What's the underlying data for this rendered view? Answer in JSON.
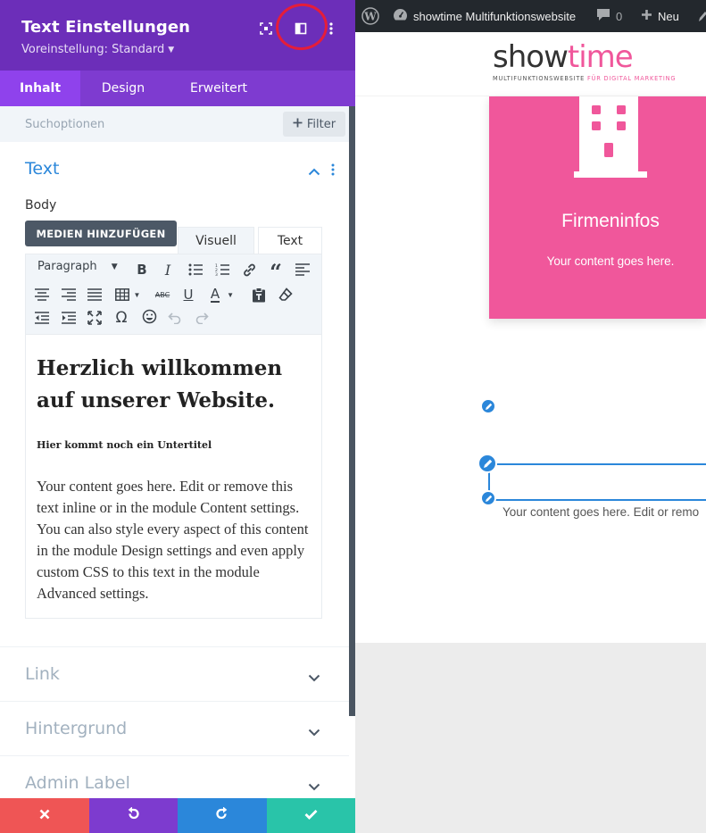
{
  "panel": {
    "title": "Text Einstellungen",
    "preset": "Voreinstellung: Standard",
    "header_icons": [
      "expand-icon",
      "sidebar-toggle-icon",
      "more-vertical-icon"
    ],
    "tabs": [
      {
        "label": "Inhalt",
        "active": true
      },
      {
        "label": "Design",
        "active": false
      },
      {
        "label": "Erweitert",
        "active": false
      }
    ],
    "search_placeholder": "Suchoptionen",
    "filter_label": "Filter",
    "section_text": {
      "title": "Text",
      "body_label": "Body",
      "media_button": "MEDIEN HINZUFÜGEN",
      "editor_tabs": [
        "Visuell",
        "Text"
      ],
      "paragraph_select": "Paragraph",
      "content_heading": "Herzlich willkommen auf unserer Website.",
      "content_subheading": "Hier kommt noch ein Untertitel",
      "content_paragraph": "Your content goes here. Edit or remove this text inline or in the module Content settings. You can also style every aspect of this content in the module Design settings and even apply custom CSS to this text in the module Advanced settings."
    },
    "collapsed_sections": [
      "Link",
      "Hintergrund",
      "Admin Label"
    ],
    "accent_colors": {
      "header": "#6c2eb9",
      "tabs": "#7e3bd0",
      "blue": "#2b87da",
      "discard": "#ef5555",
      "save": "#29c4a9"
    }
  },
  "adminbar": {
    "site_name": "showtime Multifunktionswebsite",
    "comments_count": "0",
    "new_label": "Neu"
  },
  "preview": {
    "logo_show": "show",
    "logo_time": "time",
    "logo_tag_main": "MULTIFUNKTIONSWEBSITE",
    "logo_tag_rest": " FÜR DIGITAL MARKETING",
    "card_title": "Firmeninfos",
    "card_text": "Your content goes here.",
    "module_text": "Your content goes here. Edit or remo",
    "brand_pink": "#f0579b"
  }
}
